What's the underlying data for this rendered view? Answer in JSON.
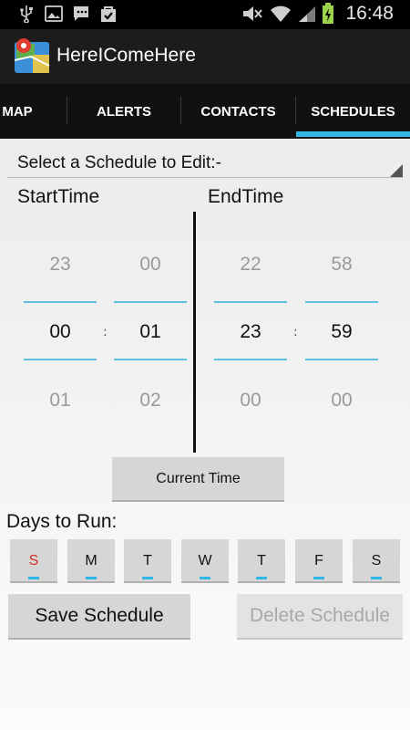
{
  "status": {
    "time": "16:48"
  },
  "app": {
    "title": "HereIComeHere"
  },
  "tabs": [
    {
      "label": "MAP"
    },
    {
      "label": "ALERTS"
    },
    {
      "label": "CONTACTS"
    },
    {
      "label": "SCHEDULES",
      "selected": true
    }
  ],
  "spinner": {
    "label": "Select a Schedule to Edit:-"
  },
  "start": {
    "label": "StartTime",
    "hour": {
      "prev": "23",
      "current": "00",
      "next": "01"
    },
    "minute": {
      "prev": "00",
      "current": "01",
      "next": "02"
    }
  },
  "end": {
    "label": "EndTime",
    "hour": {
      "prev": "22",
      "current": "23",
      "next": "00"
    },
    "minute": {
      "prev": "58",
      "current": "59",
      "next": "00"
    }
  },
  "time_separator": ":",
  "current_time_button": "Current Time",
  "days": {
    "label": "Days to Run:",
    "items": [
      "S",
      "M",
      "T",
      "W",
      "T",
      "F",
      "S"
    ]
  },
  "save_button": "Save Schedule",
  "delete_button": "Delete Schedule",
  "colors": {
    "accent": "#33b5e5",
    "sunday": "#d62b2b",
    "disabled_text": "#a8a8a8"
  }
}
